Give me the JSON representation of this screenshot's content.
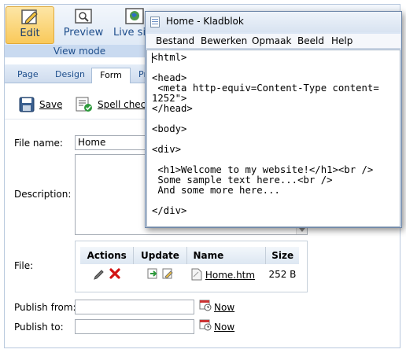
{
  "ribbon": {
    "edit_label": "Edit",
    "preview_label": "Preview",
    "live_label": "Live si",
    "view_mode_label": "View mode"
  },
  "tabs": {
    "page": "Page",
    "design": "Design",
    "form": "Form",
    "more": "Pr"
  },
  "toolbar": {
    "save_label": "Save",
    "spell_label": "Spell check"
  },
  "form": {
    "file_name_label": "File name:",
    "file_name_value": "Home",
    "description_label": "Description:",
    "description_value": "",
    "file_label": "File:",
    "publish_from_label": "Publish from:",
    "publish_from_value": "",
    "publish_from_now": "Now",
    "publish_to_label": "Publish to:",
    "publish_to_value": "",
    "publish_to_now": "Now"
  },
  "file_table": {
    "headers": [
      "Actions",
      "Update",
      "Name",
      "Size"
    ],
    "rows": [
      {
        "name": "Home.htm",
        "size": "252 B"
      }
    ]
  },
  "notepad": {
    "title": "Home - Kladblok",
    "menu": [
      "Bestand",
      "Bewerken",
      "Opmaak",
      "Beeld",
      "Help"
    ],
    "content": "<html>\n\n<head>\n <meta http-equiv=Content-Type content=\n1252\">\n</head>\n\n<body>\n\n<div>\n\n <h1>Welcome to my website!</h1><br />\n Some sample text here...<br />\n And some more here...\n\n</div>"
  }
}
